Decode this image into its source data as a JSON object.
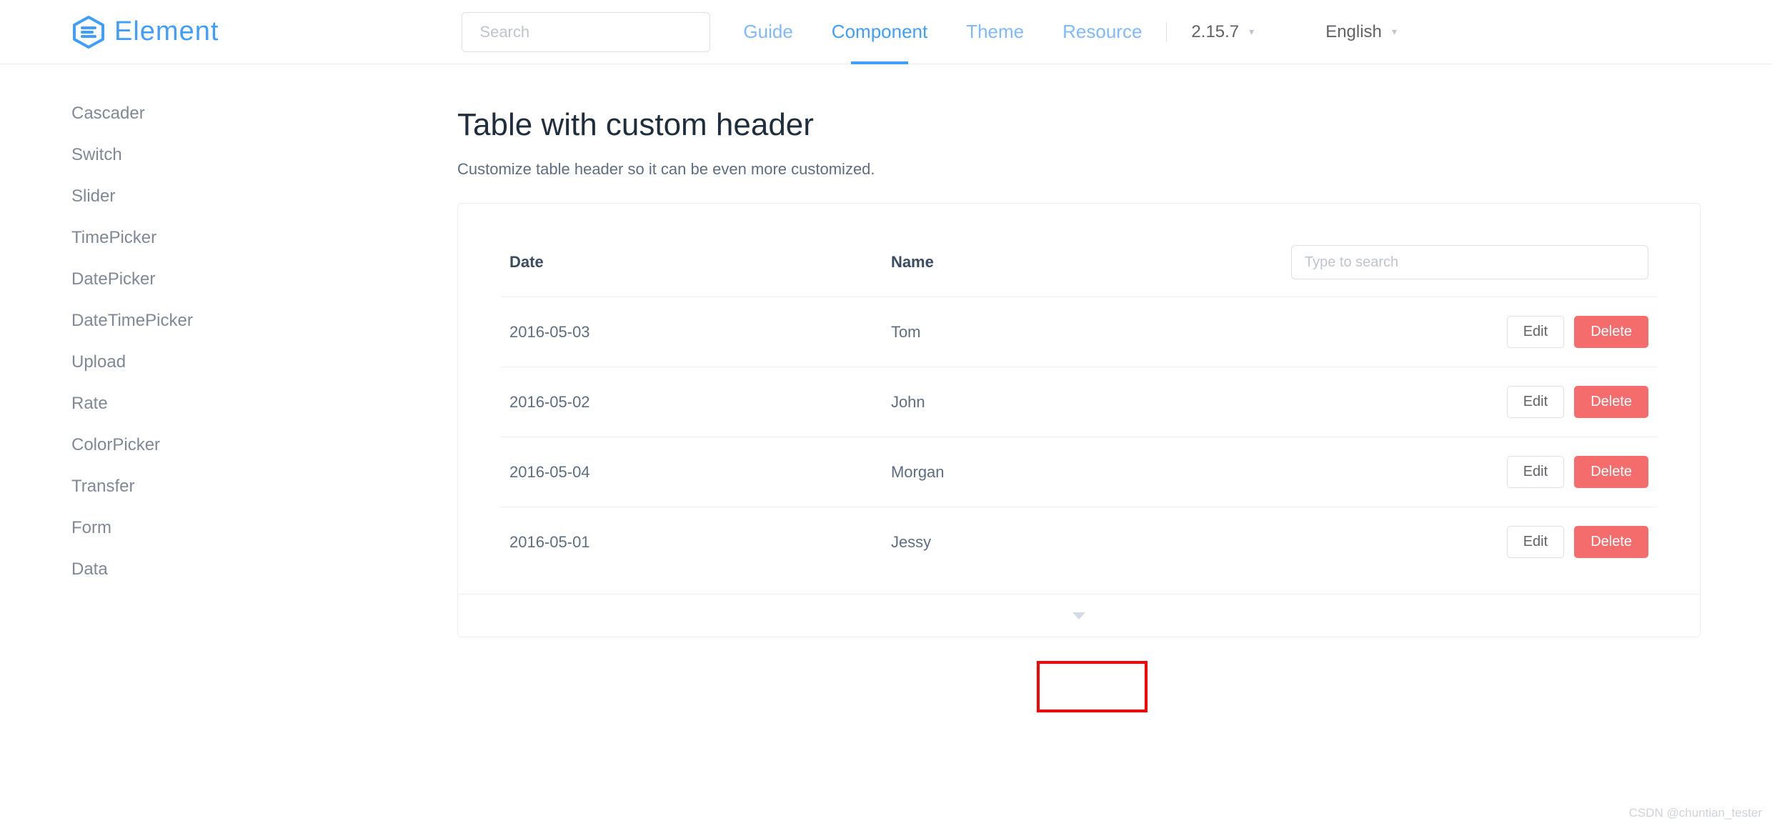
{
  "header": {
    "brand": "Element",
    "search_placeholder": "Search",
    "nav": {
      "guide": "Guide",
      "component": "Component",
      "theme": "Theme",
      "resource": "Resource"
    },
    "version": "2.15.7",
    "language": "English"
  },
  "sidebar": {
    "items": [
      "Cascader",
      "Switch",
      "Slider",
      "TimePicker",
      "DatePicker",
      "DateTimePicker",
      "Upload",
      "Rate",
      "ColorPicker",
      "Transfer",
      "Form",
      "Data"
    ]
  },
  "content": {
    "title": "Table with custom header",
    "desc": "Customize table header so it can be even more customized.",
    "table": {
      "headers": {
        "date": "Date",
        "name": "Name"
      },
      "search_placeholder": "Type to search",
      "actions": {
        "edit": "Edit",
        "delete": "Delete"
      },
      "rows": [
        {
          "date": "2016-05-03",
          "name": "Tom"
        },
        {
          "date": "2016-05-02",
          "name": "John"
        },
        {
          "date": "2016-05-04",
          "name": "Morgan"
        },
        {
          "date": "2016-05-01",
          "name": "Jessy"
        }
      ]
    }
  },
  "watermark": "CSDN @chuntian_tester"
}
